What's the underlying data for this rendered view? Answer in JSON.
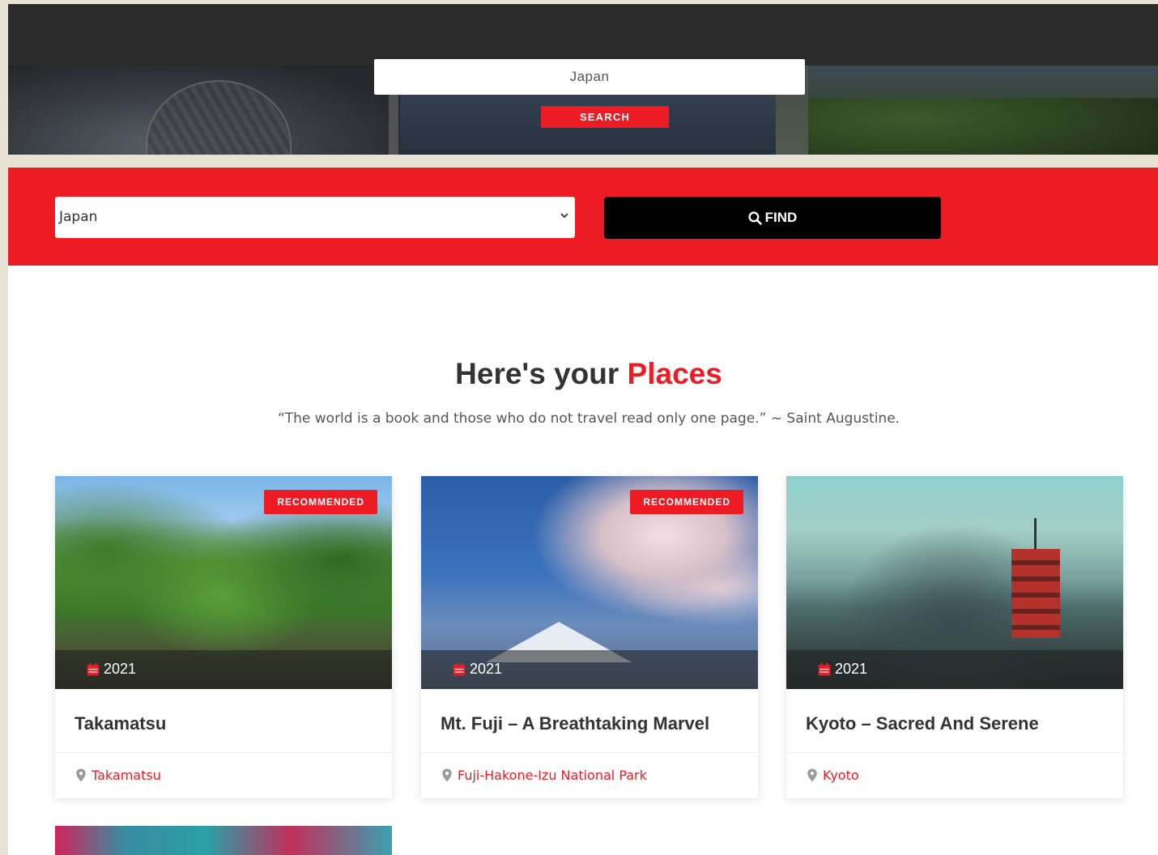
{
  "hero": {
    "search_value": "Japan",
    "search_button": "SEARCH"
  },
  "filter": {
    "selected_country": "Japan",
    "find_button": "FIND"
  },
  "heading": {
    "prefix": "Here's your",
    "accent": "Places"
  },
  "quote": "“The world is a book and those who do not travel read only one page.” ~ Saint Augustine.",
  "cards": [
    {
      "title": "Takamatsu",
      "year": "2021",
      "location": "Takamatsu",
      "badge": "RECOMMENDED"
    },
    {
      "title": "Mt. Fuji – A Breathtaking Marvel",
      "year": "2021",
      "location": "Fuji-Hakone-Izu National Park",
      "badge": "RECOMMENDED"
    },
    {
      "title": "Kyoto – Sacred And Serene",
      "year": "2021",
      "location": "Kyoto",
      "badge": ""
    }
  ],
  "colors": {
    "accent": "#ed1c24",
    "dark": "#333333",
    "find_button_bg": "#000000"
  },
  "icons": {
    "find": "search-icon",
    "year": "calendar-icon",
    "location": "map-marker-icon",
    "select": "chevron-down-icon"
  }
}
